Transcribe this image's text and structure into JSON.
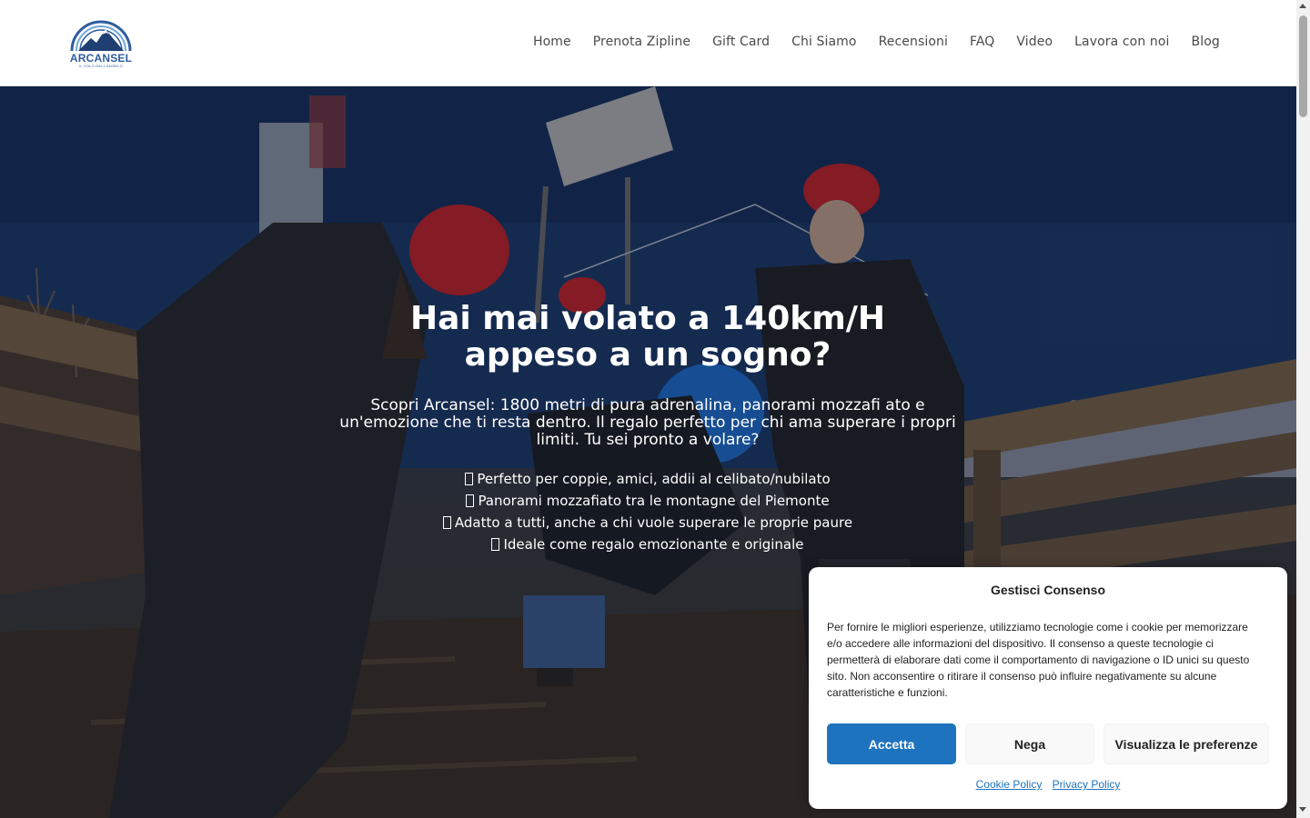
{
  "brand": {
    "name": "ARCANSEL",
    "tagline": "IL VOLO DELL'ANGELO"
  },
  "nav": {
    "items": [
      "Home",
      "Prenota Zipline",
      "Gift Card",
      "Chi Siamo",
      "Recensioni",
      "FAQ",
      "Video",
      "Lavora con noi",
      "Blog"
    ]
  },
  "hero": {
    "title_line1": "Hai mai volato a 140km/H",
    "title_line2": "appeso a un sogno?",
    "subtitle": "Scopri Arcansel: 1800 metri di pura adrenalina, panorami mozzafi ato e un'emozione che ti resta dentro. Il regalo perfetto per chi ama superare i propri limiti. Tu sei pronto a volare?",
    "bullets": [
      "Perfetto per coppie, amici, addii al celibato/nubilato",
      "Panorami mozzafiato tra le montagne del Piemonte",
      "Adatto a tutti, anche a chi vuole superare le proprie paure",
      "Ideale come regalo emozionante e originale"
    ]
  },
  "cookie": {
    "title": "Gestisci Consenso",
    "text": "Per fornire le migliori esperienze, utilizziamo tecnologie come i cookie per memorizzare e/o accedere alle informazioni del dispositivo. Il consenso a queste tecnologie ci permetterà di elaborare dati come il comportamento di navigazione o ID unici su questo sito. Non acconsentire o ritirare il consenso può influire negativamente su alcune caratteristiche e funzioni.",
    "accept_label": "Accetta",
    "deny_label": "Nega",
    "prefs_label": "Visualizza le preferenze",
    "cookie_policy_label": "Cookie Policy",
    "privacy_policy_label": "Privacy Policy"
  },
  "colors": {
    "accent": "#1e73be",
    "logo_blue": "#2f5d9e"
  }
}
